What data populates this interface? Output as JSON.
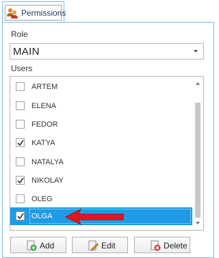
{
  "tab": {
    "label": "Permissions",
    "icon": "users-icon"
  },
  "role": {
    "label": "Role",
    "value": "MAIN"
  },
  "users": {
    "label": "Users",
    "items": [
      {
        "name": "ARTEM",
        "checked": false
      },
      {
        "name": "ELENA",
        "checked": false
      },
      {
        "name": "FEDOR",
        "checked": false
      },
      {
        "name": "KATYA",
        "checked": true
      },
      {
        "name": "NATALYA",
        "checked": false
      },
      {
        "name": "NIKOLAY",
        "checked": true
      },
      {
        "name": "OLEG",
        "checked": false
      },
      {
        "name": "OLGA",
        "checked": true,
        "selected": true
      }
    ]
  },
  "buttons": {
    "add": "Add",
    "edit": "Edit",
    "delete": "Delete"
  },
  "colors": {
    "selection": "#1e9be6",
    "arrow": "#e8151a",
    "tab_border": "#7ab8e6"
  }
}
